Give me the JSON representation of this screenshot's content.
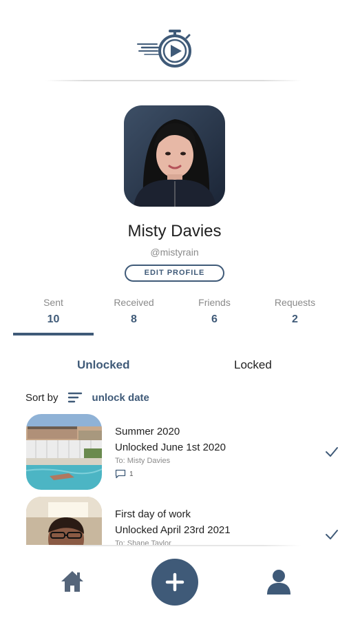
{
  "app": {
    "logo_icon": "stopwatch-play-logo"
  },
  "profile": {
    "name": "Misty Davies",
    "handle": "@mistyrain",
    "edit_label": "EDIT PROFILE",
    "avatar": "profile-photo"
  },
  "stats": [
    {
      "label": "Sent",
      "value": "10"
    },
    {
      "label": "Received",
      "value": "8"
    },
    {
      "label": "Friends",
      "value": "6"
    },
    {
      "label": "Requests",
      "value": "2"
    }
  ],
  "tabs": {
    "unlocked": "Unlocked",
    "locked": "Locked"
  },
  "sort": {
    "label": "Sort by",
    "value": "unlock date",
    "icon": "sort-lines-icon"
  },
  "capsules": [
    {
      "title": "Summer 2020",
      "date_text": "Unlocked June 1st 2020",
      "to": "To: Misty Davies",
      "comments": "1",
      "status_icon": "checkmark-icon"
    },
    {
      "title": "First day of work",
      "date_text": "Unlocked April 23rd 2021",
      "to": "To: Shane Taylor",
      "status_icon": "checkmark-icon"
    }
  ],
  "nav": {
    "home_icon": "home-icon",
    "add_icon": "plus-icon",
    "profile_icon": "user-icon"
  },
  "colors": {
    "accent": "#3f5a78",
    "muted": "#8a8a8a",
    "background": "#ffffff"
  }
}
